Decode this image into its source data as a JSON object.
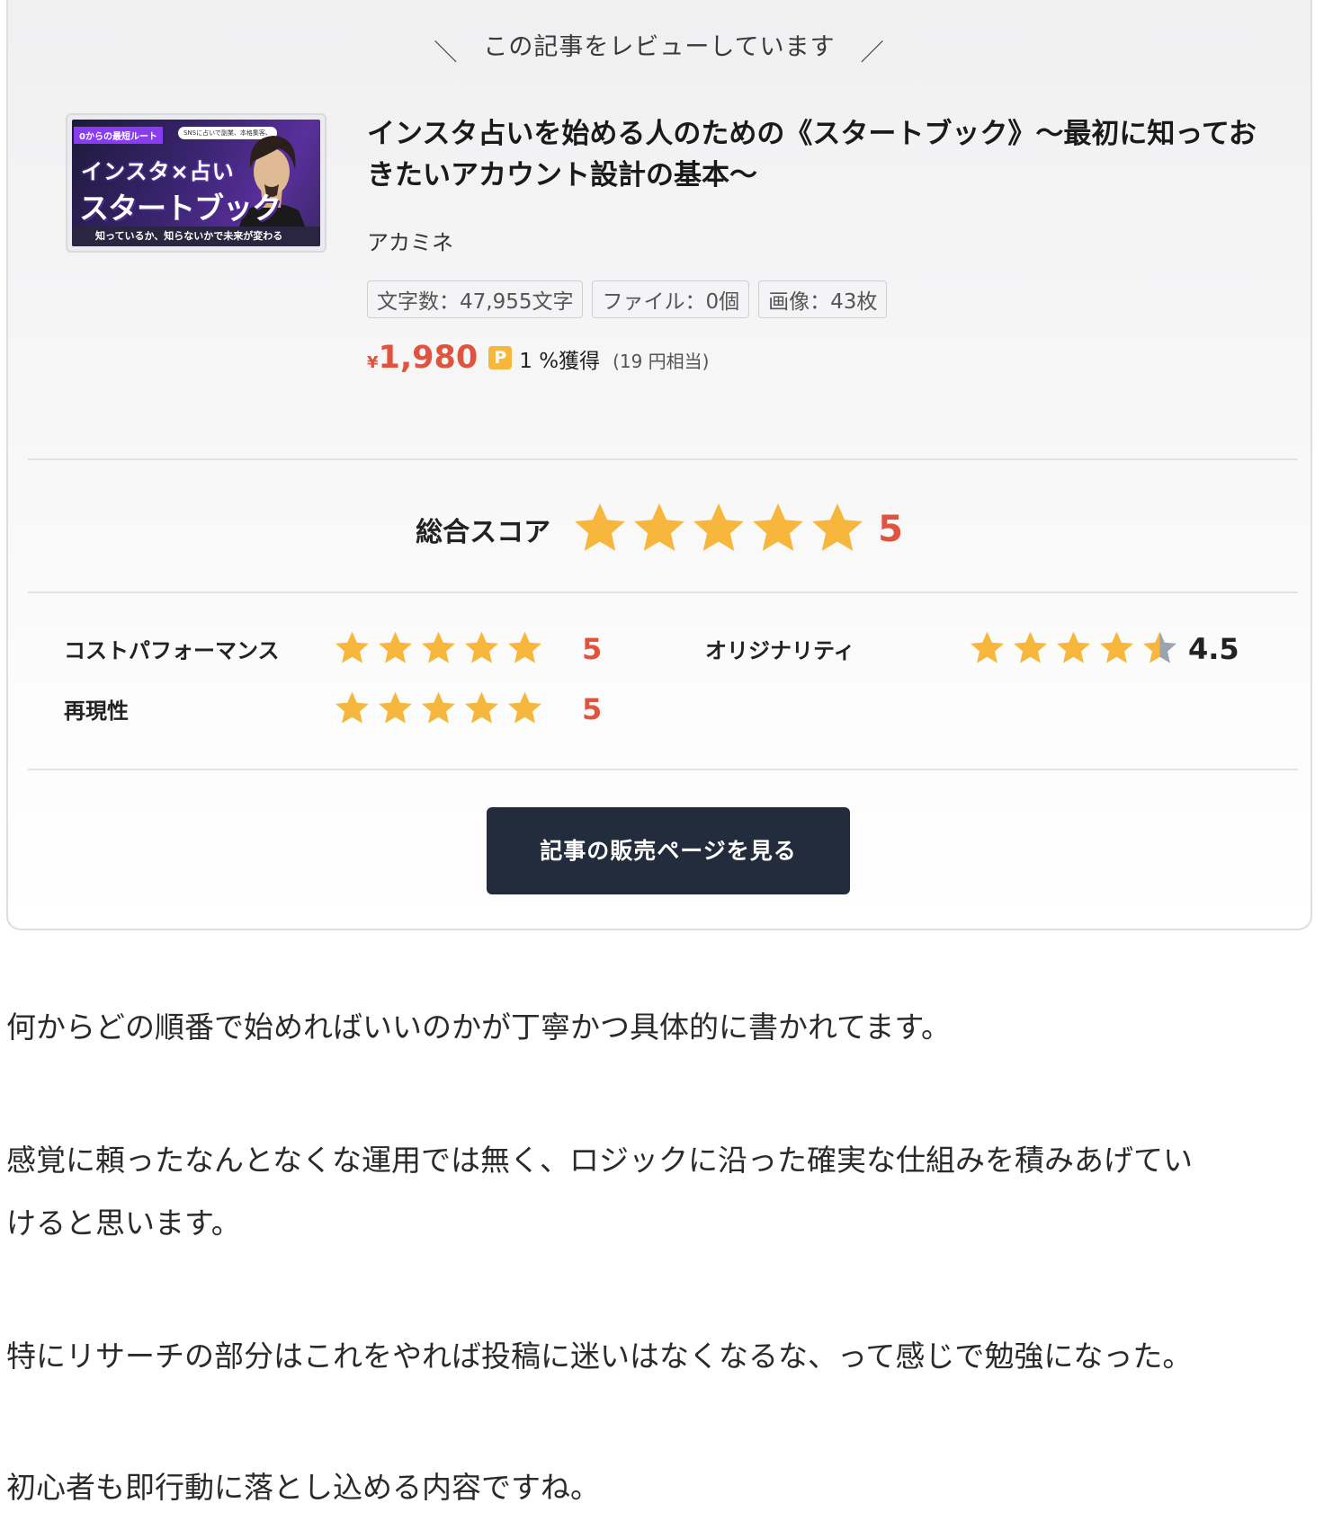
{
  "card": {
    "review_label": "この記事をレビューしています",
    "thumbnail": {
      "badge": "0からの最短ルート",
      "bubble": "SNSに占いで副業、本格集客、",
      "line1": "インスタ×占い",
      "line2": "スタートブック",
      "footer": "知っているか、知らないかで未来が変わる"
    },
    "title": "インスタ占いを始める人のための《スタートブック》〜最初に知っておきたいアカウント設計の基本〜",
    "author": "アカミネ",
    "tags": [
      "文字数：47,955文字",
      "ファイル：0個",
      "画像：43枚"
    ],
    "price": {
      "yen_mark": "¥",
      "amount": "1,980",
      "point_icon": "P",
      "rate": "1 %獲得",
      "equivalent": "(19 円相当)"
    },
    "overall": {
      "label": "総合スコア",
      "value": "5",
      "rating": 5
    },
    "criteria": [
      {
        "label": "コストパフォーマンス",
        "value": "5",
        "rating": 5
      },
      {
        "label": "オリジナリティ",
        "value": "4.5",
        "rating": 4.5
      },
      {
        "label": "再現性",
        "value": "5",
        "rating": 5
      }
    ],
    "button_label": "記事の販売ページを見る"
  },
  "paragraphs": [
    "何からどの順番で始めればいいのかが丁寧かつ具体的に書かれてます。",
    "感覚に頼ったなんとなくな運用では無く、ロジックに沿った確実な仕組みを積みあげてい",
    "けると思います。",
    "特にリサーチの部分はこれをやれば投稿に迷いはなくなるな、って感じで勉強になった。",
    "初心者も即行動に落とし込める内容ですね。"
  ],
  "colors": {
    "accent_red": "#e0533f",
    "star_gold": "#f6b73c",
    "star_gray": "#9aa3b0",
    "button_bg": "#222c3c"
  },
  "icons": [
    "star-icon",
    "point-icon"
  ]
}
